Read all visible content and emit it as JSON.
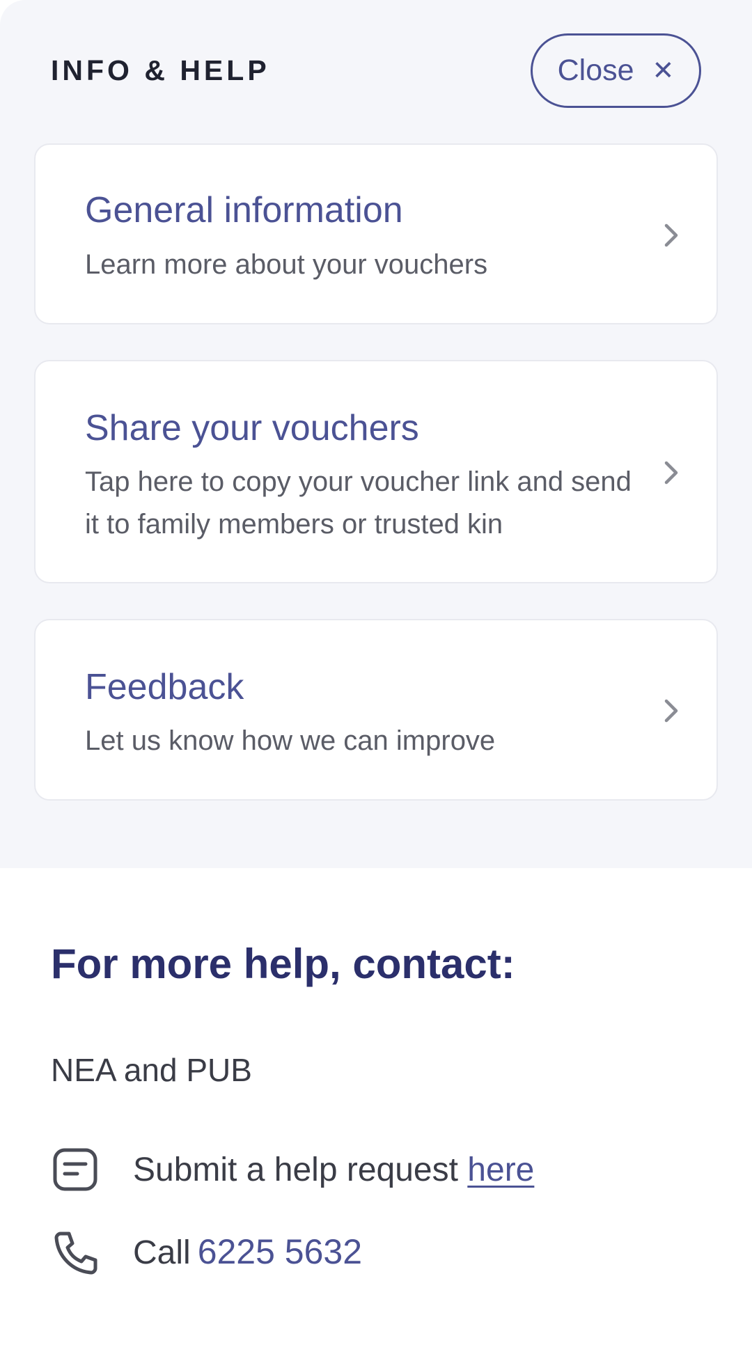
{
  "header": {
    "title": "INFO & HELP",
    "close_label": "Close",
    "close_icon": "close-icon"
  },
  "menu": {
    "items": [
      {
        "title": "General information",
        "description": "Learn more about your vouchers",
        "icon": "chevron-right-icon"
      },
      {
        "title": "Share your vouchers",
        "description": "Tap here to copy your voucher link and send it to family members or trusted kin",
        "icon": "chevron-right-icon"
      },
      {
        "title": "Feedback",
        "description": "Let us know how we can improve",
        "icon": "chevron-right-icon"
      }
    ]
  },
  "contact": {
    "heading": "For more help, contact:",
    "organisation": "NEA and PUB",
    "help_request": {
      "prefix": "Submit a help request",
      "link_text": "here",
      "icon": "message-icon"
    },
    "call": {
      "prefix": "Call",
      "number": "6225 5632",
      "icon": "phone-icon"
    }
  },
  "colors": {
    "accent": "#4b5294",
    "heading": "#2b2f6b",
    "panel_background": "#f5f6fa"
  }
}
